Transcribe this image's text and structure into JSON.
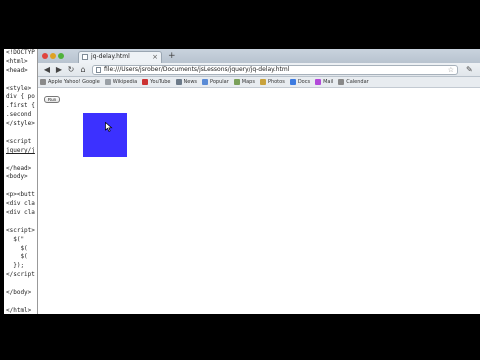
{
  "editor": {
    "lines": [
      "<!DOCTYP",
      "<html>",
      "<head>",
      "",
      "<style>",
      "div { po",
      ".first {",
      ".second",
      "</style>",
      "",
      "<script",
      "jquery/j",
      "",
      "</head>",
      "<body>",
      "",
      "<p><butt",
      "<div cla",
      "<div cla",
      "",
      "<script>",
      "  $(\"",
      "    $(",
      "    $(",
      "  });",
      "</script",
      "",
      "</body>",
      "",
      "</html>"
    ]
  },
  "browser": {
    "tab_title": "jq-delay.html",
    "tab_close": "×",
    "new_tab": "+",
    "address": "file:///Users/jsrober/Documents/jsLessons/jquery/jq-delay.html",
    "nav": {
      "back": "◀",
      "forward": "▶",
      "reload": "↻",
      "home": "⌂"
    },
    "star": "☆",
    "wrench": "✎",
    "bookmarks": [
      {
        "label": "Apple  Yahoo!  Google",
        "color": "#8a8a8a"
      },
      {
        "label": "Wikipedia",
        "color": "#9aa0a6"
      },
      {
        "label": "YouTube",
        "color": "#c33"
      },
      {
        "label": "News",
        "color": "#6c7a89"
      },
      {
        "label": "Popular",
        "color": "#5a8bd6"
      },
      {
        "label": "Maps",
        "color": "#7aa05a"
      },
      {
        "label": "Photos",
        "color": "#c9a23c"
      },
      {
        "label": "Docs",
        "color": "#3d7be0"
      },
      {
        "label": "Mail",
        "color": "#b24ad9"
      },
      {
        "label": "Calendar",
        "color": "#888"
      }
    ]
  },
  "page": {
    "run_label": "Run"
  },
  "colors": {
    "first_box": "#3c31ff"
  }
}
